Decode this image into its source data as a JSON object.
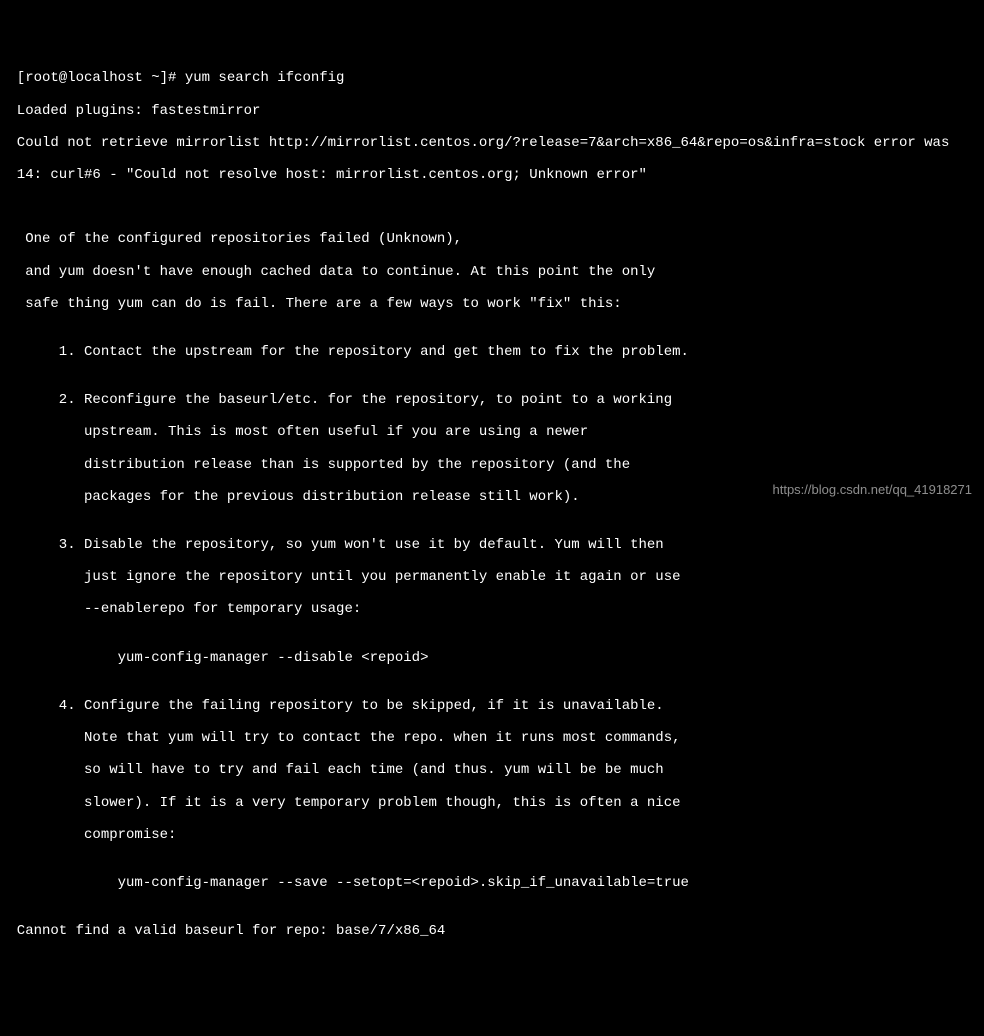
{
  "lines": {
    "l0": "  [root@localhost ~]# yum search ifconfig",
    "l1": "  Loaded plugins: fastestmirror",
    "l2": "  Could not retrieve mirrorlist http://mirrorlist.centos.org/?release=7&arch=x86_64&repo=os&infra=stock error was",
    "l3": "  14: curl#6 - \"Could not resolve host: mirrorlist.centos.org; Unknown error\"",
    "l4": "",
    "l5": "",
    "l6": "   One of the configured repositories failed (Unknown),",
    "l7": "   and yum doesn't have enough cached data to continue. At this point the only",
    "l8": "   safe thing yum can do is fail. There are a few ways to work \"fix\" this:",
    "l9": "",
    "l10": "       1. Contact the upstream for the repository and get them to fix the problem.",
    "l11": "",
    "l12": "       2. Reconfigure the baseurl/etc. for the repository, to point to a working",
    "l13": "          upstream. This is most often useful if you are using a newer",
    "l14": "          distribution release than is supported by the repository (and the",
    "l15": "          packages for the previous distribution release still work).",
    "l16": "",
    "l17": "       3. Disable the repository, so yum won't use it by default. Yum will then",
    "l18": "          just ignore the repository until you permanently enable it again or use",
    "l19": "          --enablerepo for temporary usage:",
    "l20": "",
    "l21": "              yum-config-manager --disable <repoid>",
    "l22": "",
    "l23": "       4. Configure the failing repository to be skipped, if it is unavailable.",
    "l24": "          Note that yum will try to contact the repo. when it runs most commands,",
    "l25": "          so will have to try and fail each time (and thus. yum will be be much",
    "l26": "          slower). If it is a very temporary problem though, this is often a nice",
    "l27": "          compromise:",
    "l28": "",
    "l29": "              yum-config-manager --save --setopt=<repoid>.skip_if_unavailable=true",
    "l30": "",
    "l31": "  Cannot find a valid baseurl for repo: base/7/x86_64"
  },
  "watermark": "https://blog.csdn.net/qq_41918271"
}
